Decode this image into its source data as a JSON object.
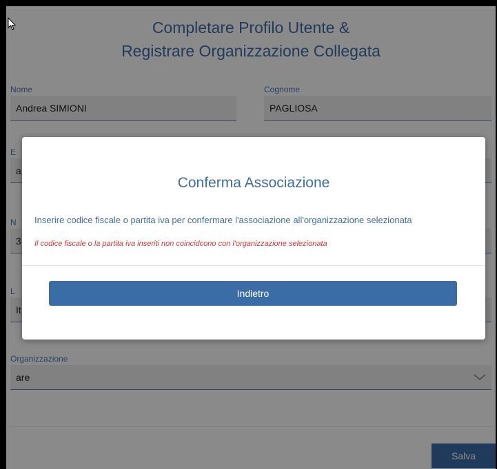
{
  "page": {
    "title_line1": "Completare Profilo Utente &",
    "title_line2": "Registrare Organizzazione Collegata"
  },
  "form": {
    "nome": {
      "label": "Nome",
      "value": "Andrea SIMIONI"
    },
    "cognome": {
      "label": "Cognome",
      "value": "PAGLIOSA"
    },
    "partial_fields": [
      {
        "label": "E",
        "value": "a"
      },
      {
        "label": "N",
        "value": "3"
      },
      {
        "label": "L",
        "value": "It"
      }
    ],
    "organizzazione": {
      "label": "Organizzazione",
      "value": "are",
      "icon": "chevron-down-icon"
    }
  },
  "actions": {
    "save_label": "Salva"
  },
  "modal": {
    "title": "Conferma Associazione",
    "description": "Inserire codice fiscale o partita iva per confermare l'associazione all'organizzazione selezionata",
    "error": "Il codice fiscale o la partita iva inseriti non coincidcono con l'organizzazione selezionata",
    "back_label": "Indietro"
  },
  "colors": {
    "accent": "#3a6ca6",
    "title": "#3d6ea6",
    "error": "#e23030",
    "field_bg": "#efefef"
  }
}
